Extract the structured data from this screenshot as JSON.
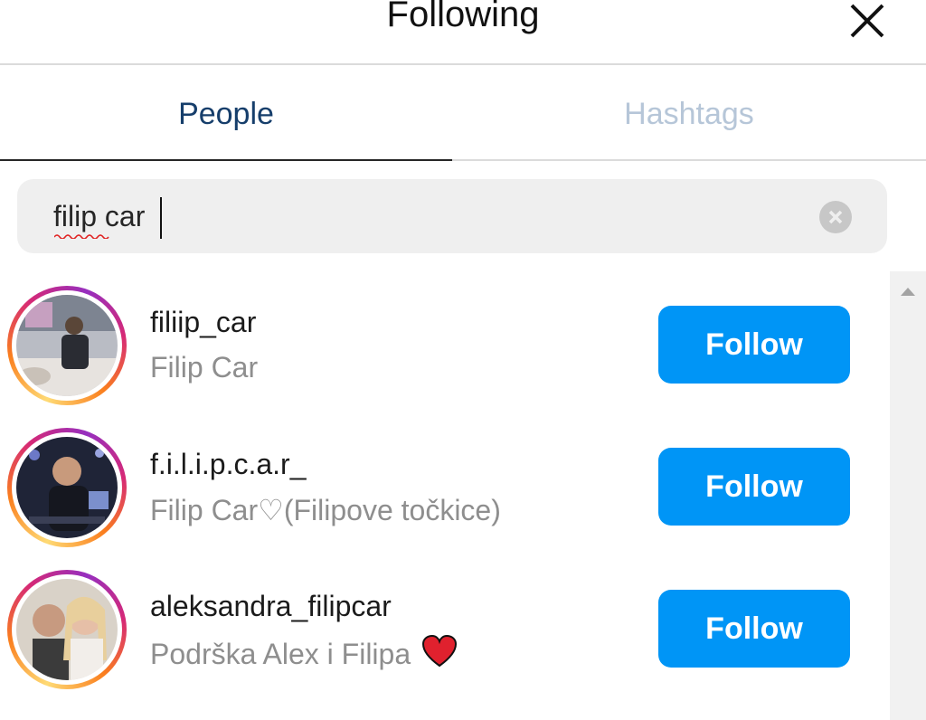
{
  "header": {
    "title": "Following",
    "close_icon": "close-icon"
  },
  "tabs": [
    {
      "label": "People",
      "active": true
    },
    {
      "label": "Hashtags",
      "active": false
    }
  ],
  "search": {
    "value": "filip car",
    "clear_icon": "clear-circle-icon"
  },
  "results": [
    {
      "username": "filiip_car",
      "full_name": "Filip Car",
      "button": "Follow"
    },
    {
      "username": "f.i.l.i.p.c.a.r_",
      "full_name": "Filip Car♡(Filipove točkice)",
      "button": "Follow"
    },
    {
      "username": "aleksandra_filipcar",
      "full_name": "Podrška Alex i Filipa",
      "button": "Follow",
      "emoji": "red-heart-emoji"
    }
  ],
  "colors": {
    "accent": "#0095f6",
    "active_tab": "#163e6b",
    "inactive_tab": "#b6c6d8",
    "muted_text": "#8e8e8e"
  }
}
